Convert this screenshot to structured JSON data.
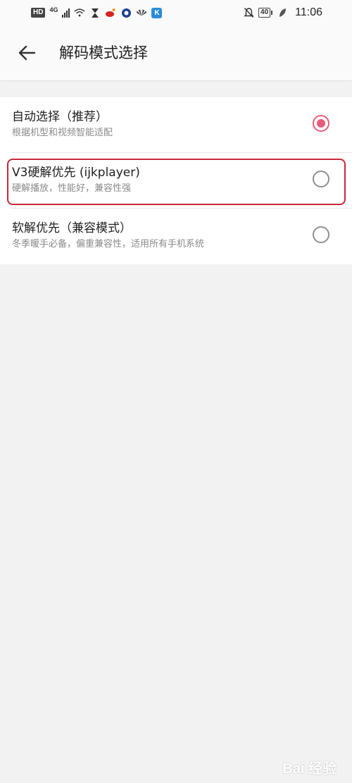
{
  "status_bar": {
    "hd": "HD",
    "network": "4G",
    "battery": "40",
    "time": "11:06",
    "icons": [
      "signal-icon",
      "wifi-icon",
      "hourglass-icon",
      "weibo-icon",
      "circle-app-icon",
      "huawei-icon",
      "k-app-icon",
      "mute-bell-icon",
      "battery-icon",
      "leaf-icon"
    ]
  },
  "app_bar": {
    "back_icon": "arrow-left-icon",
    "title": "解码模式选择"
  },
  "options": [
    {
      "label": "自动选择（推荐）",
      "description": "根据机型和视频智能适配",
      "selected": true
    },
    {
      "label": "V3硬解优先 (ijkplayer)",
      "description": "硬解播放，性能好，兼容性强",
      "selected": false
    },
    {
      "label": "软解优先（兼容模式）",
      "description": "冬季暖手必备，偏重兼容性，适用所有手机系统",
      "selected": false
    }
  ],
  "colors": {
    "accent": "#e85c7a",
    "highlight": "#c8283c"
  },
  "watermark": "Bai 经验"
}
